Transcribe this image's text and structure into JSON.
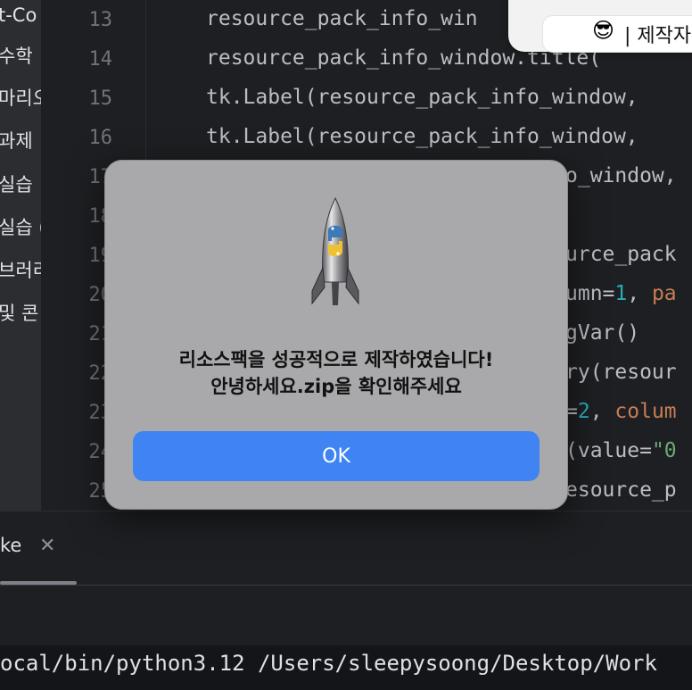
{
  "sidebar": {
    "items": [
      "t-Co",
      "수학",
      "마리오",
      "과제",
      "실습",
      "실습 (",
      "브러리",
      "및 콘"
    ]
  },
  "editor": {
    "line_numbers": [
      "13",
      "14",
      "15",
      "16",
      "17",
      "18",
      "19",
      "20",
      "21",
      "22",
      "23",
      "24",
      "25"
    ],
    "lines": [
      [
        "resource_pack_info_win"
      ],
      [
        "resource_pack_info_window.title("
      ],
      [
        "tk.Label(resource_pack_info_window,"
      ],
      [
        "tk.Label(resource_pack_info_window,"
      ],
      [
        "o_window,"
      ],
      [
        ""
      ],
      [
        "urce_pack"
      ],
      [
        "umn=",
        "1",
        ", ",
        "pa"
      ],
      [
        "gVar()"
      ],
      [
        "ry(resour"
      ],
      [
        "=",
        "2",
        ", ",
        "colum"
      ],
      [
        "(value=",
        "\"0"
      ],
      [
        "esource_p"
      ]
    ]
  },
  "notification": {
    "emoji": "😎",
    "text": "| 제작자"
  },
  "dialog": {
    "message_line1": "리소스팩을 성공적으로 제작하였습니다!",
    "message_line2": "안녕하세요.zip을 확인해주세요",
    "ok_label": "OK",
    "icon": "python-launcher-rocket-icon"
  },
  "bottom_panel": {
    "tab_label": "ke",
    "close_icon": "close-icon",
    "console_text": "ocal/bin/python3.12 /Users/sleepysoong/Desktop/Work"
  },
  "colors": {
    "background": "#1e1f22",
    "dialog_bg": "#a9a9ab",
    "ok_button": "#3f84f2",
    "number": "#2aacb8",
    "param": "#c77d55",
    "string": "#6aab73"
  }
}
